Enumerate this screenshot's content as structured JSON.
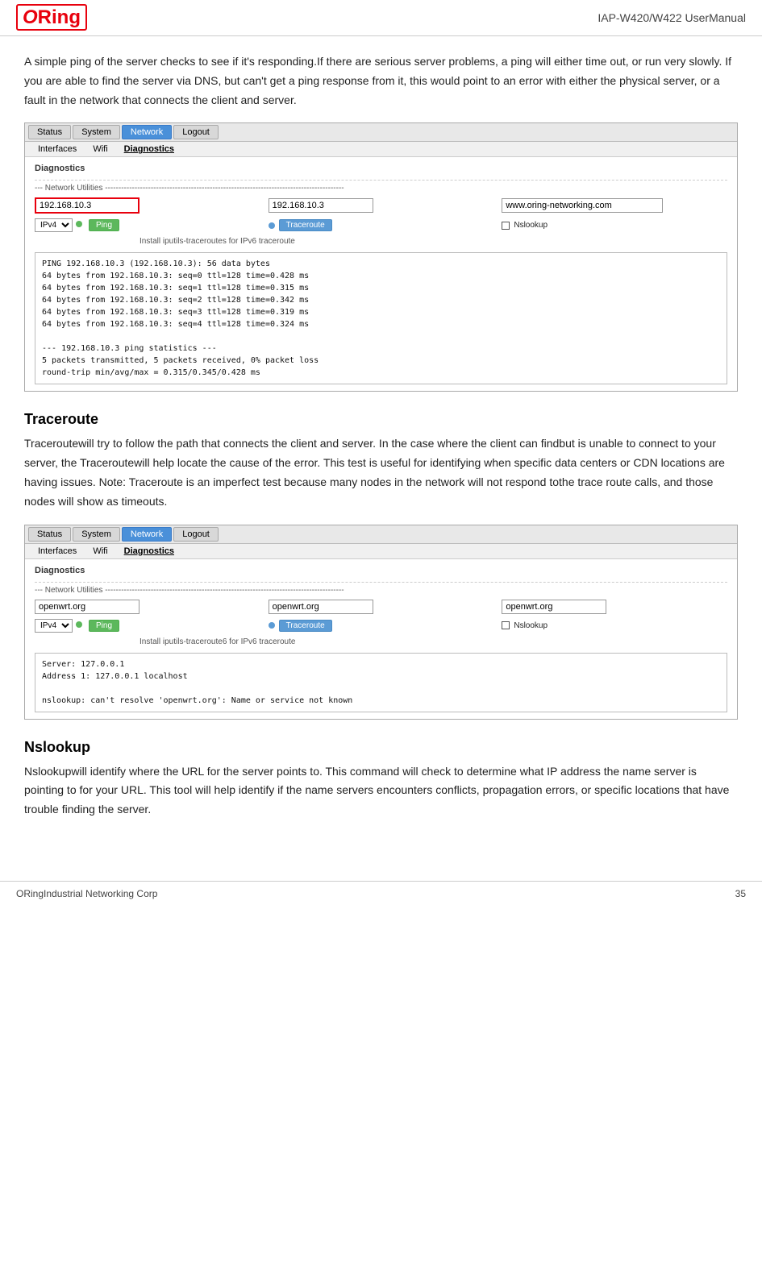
{
  "header": {
    "logo_text": "ORing",
    "title": "IAP-W420/W422  UserManual"
  },
  "intro_paragraph": "A simple ping of the server checks to see if it's responding.If there are serious server problems, a ping will either time out, or run very slowly. If you are able to find the server via DNS, but can't get a ping response from it, this would point to an error with either the physical server, or a fault in the network that connects the client and server.",
  "ping_mockup": {
    "nav_buttons": [
      "Status",
      "System",
      "Network",
      "Logout"
    ],
    "active_nav": "Network",
    "sub_nav_buttons": [
      "Interfaces",
      "Wifi",
      "Diagnostics"
    ],
    "active_sub": "Diagnostics",
    "section_title": "Diagnostics",
    "network_utilities_label": "--- Network Utilities ---",
    "input1_value": "192.168.10.3",
    "input2_value": "192.168.10.3",
    "input3_value": "www.oring-networking.com",
    "ipv4_label": "IPv4",
    "ping_btn": "Ping",
    "traceroute_btn": "Traceroute",
    "nslookup_btn": "Nslookup",
    "ipv6_note": "Install iputils-traceroutes for IPv6 traceroute",
    "output_lines": [
      "PING 192.168.10.3 (192.168.10.3): 56 data bytes",
      "64 bytes from 192.168.10.3: seq=0 ttl=128 time=0.428 ms",
      "64 bytes from 192.168.10.3: seq=1 ttl=128 time=0.315 ms",
      "64 bytes from 192.168.10.3: seq=2 ttl=128 time=0.342 ms",
      "64 bytes from 192.168.10.3: seq=3 ttl=128 time=0.319 ms",
      "64 bytes from 192.168.10.3: seq=4 ttl=128 time=0.324 ms",
      "",
      "--- 192.168.10.3 ping statistics ---",
      "5 packets transmitted, 5 packets received, 0% packet loss",
      "round-trip min/avg/max = 0.315/0.345/0.428 ms"
    ]
  },
  "traceroute_section": {
    "heading": "Traceroute",
    "paragraph": "Traceroutewill try to follow the path that connects the client and server. In the case where the client can findbut is unable to connect to your server, the Traceroutewill help locate the cause of the error. This test is useful for identifying when specific data centers or CDN locations are having issues. Note: Traceroute is an imperfect test because many nodes in the network will not respond tothe trace route calls, and those nodes will show as timeouts."
  },
  "traceroute_mockup": {
    "nav_buttons": [
      "Status",
      "System",
      "Network",
      "Logout"
    ],
    "active_nav": "Network",
    "sub_nav_buttons": [
      "Interfaces",
      "Wifi",
      "Diagnostics"
    ],
    "active_sub": "Diagnostics",
    "section_title": "Diagnostics",
    "network_utilities_label": "--- Network Utilities ---",
    "input1_value": "openwrt.org",
    "input2_value": "openwrt.org",
    "input3_value": "openwrt.org",
    "ipv4_label": "IPv4",
    "ping_btn": "Ping",
    "traceroute_btn": "Traceroute",
    "nslookup_btn": "Nslookup",
    "ipv6_note": "Install iputils-traceroute6 for IPv6 traceroute",
    "output_lines": [
      "Server:  127.0.0.1",
      "Address 1: 127.0.0.1 localhost",
      "",
      "nslookup: can't resolve 'openwrt.org': Name or service not known"
    ]
  },
  "nslookup_section": {
    "heading": "Nslookup",
    "paragraph": "Nslookupwill identify where the URL for the server points to. This command will check to determine what IP address the name server is pointing to for your URL. This tool will help identify if the name servers encounters conflicts, propagation errors, or specific locations that have trouble finding the server."
  },
  "footer": {
    "company": "ORingIndustrial Networking Corp",
    "page_number": "35"
  }
}
